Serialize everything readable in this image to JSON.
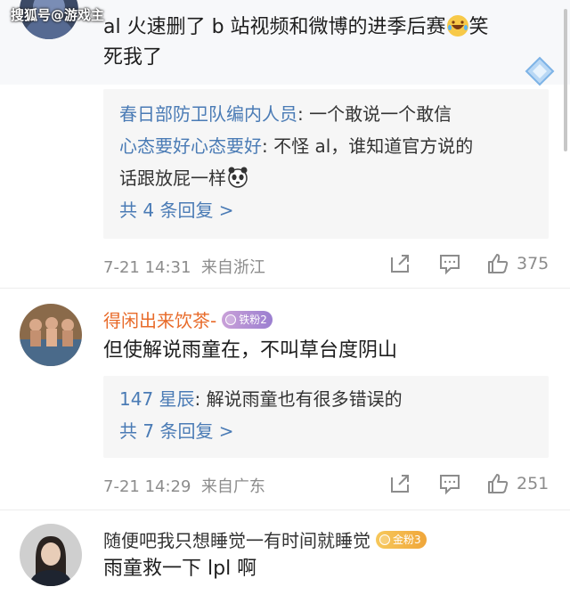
{
  "watermark": "搜狐号@游戏主",
  "comments": [
    {
      "text_line1": "al 火速删了 b 站视频和微博的进季后赛",
      "text_line1_suffix": "笑",
      "text_line2": "死我了",
      "replies": [
        {
          "user": "春日部防卫队编内人员",
          "text": ": 一个敢说一个敢信"
        },
        {
          "user": "心态要好心态要好",
          "text": ": 不怪 al，谁知道官方说的",
          "text_cont": "话跟放屁一样"
        }
      ],
      "more_replies": "共 4 条回复 >",
      "time": "7-21 14:31",
      "source": "来自浙江",
      "likes": "375"
    },
    {
      "username": "得闲出来饮茶-",
      "badge": "铁粉2",
      "text": "但使解说雨童在，不叫草台度阴山",
      "replies": [
        {
          "user": "147 星辰",
          "text": ": 解说雨童也有很多错误的"
        }
      ],
      "more_replies": "共 7 条回复 >",
      "time": "7-21 14:29",
      "source": "来自广东",
      "likes": "251"
    },
    {
      "username": "随便吧我只想睡觉一有时间就睡觉",
      "badge": "金粉3",
      "text": "雨童救一下 lpl 啊"
    }
  ],
  "icons": {
    "share": "share-icon",
    "comment": "comment-icon",
    "like": "thumbs-up-icon"
  }
}
